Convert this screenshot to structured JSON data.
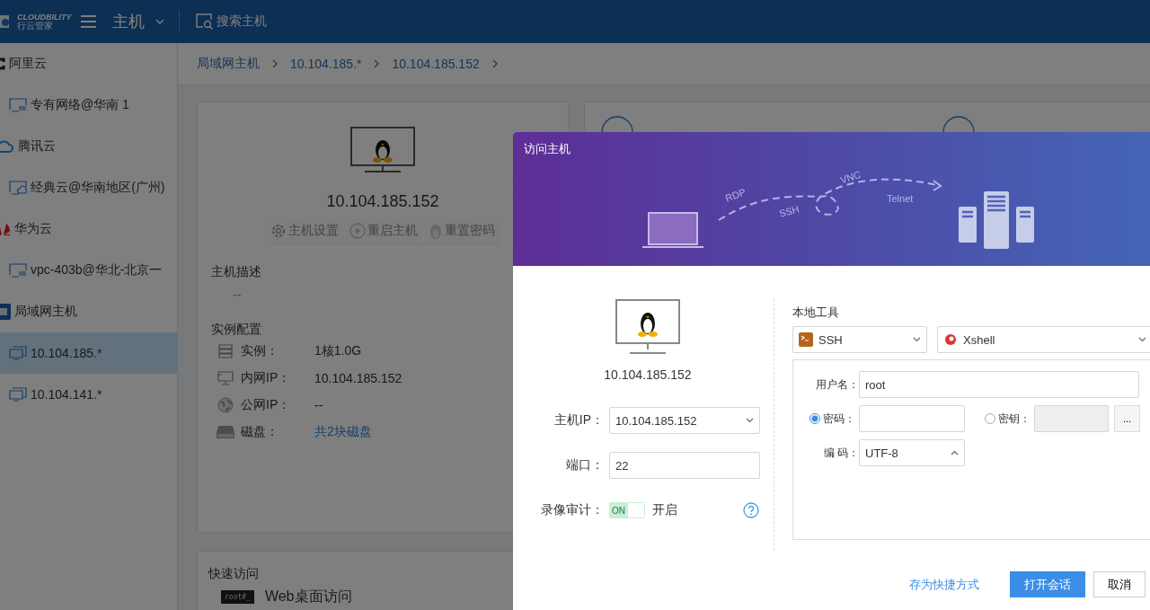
{
  "header": {
    "brand": "CLOUDBILITY",
    "brand_sub": "行云管家",
    "section": "主机",
    "search": "搜索主机"
  },
  "sidebar": {
    "items": [
      {
        "label": "阿里云",
        "kind": "aliyun",
        "selected": false,
        "children": [
          {
            "label": "专有网络@华南 1",
            "kind": "vpc",
            "selected": false
          }
        ]
      },
      {
        "label": "腾讯云",
        "kind": "tencent",
        "selected": false,
        "children": [
          {
            "label": "经典云@华南地区(广州)",
            "kind": "classic",
            "selected": false
          }
        ]
      },
      {
        "label": "华为云",
        "kind": "huawei",
        "selected": false,
        "children": [
          {
            "label": "vpc-403b@华北-北京一",
            "kind": "vpc",
            "selected": false
          }
        ]
      },
      {
        "label": "局域网主机",
        "kind": "lan",
        "selected": false,
        "children": [
          {
            "label": "10.104.185.*",
            "kind": "host",
            "selected": true
          },
          {
            "label": "10.104.141.*",
            "kind": "host",
            "selected": false
          }
        ]
      }
    ]
  },
  "breadcrumb": [
    "局域网主机",
    "10.104.185.*",
    "10.104.185.152"
  ],
  "host_card": {
    "ip": "10.104.185.152",
    "actions": [
      {
        "label": "主机设置",
        "kind": "gear"
      },
      {
        "label": "重启主机",
        "kind": "play"
      },
      {
        "label": "重置密码",
        "kind": "penguin"
      }
    ],
    "description_title": "主机描述",
    "description": "--",
    "config_title": "实例配置",
    "config": [
      {
        "kind": "instance",
        "label": "实例：",
        "value": "1核1.0G",
        "link": false
      },
      {
        "kind": "lan",
        "label": "内网IP：",
        "value": "10.104.185.152",
        "link": false
      },
      {
        "kind": "globe",
        "label": "公网IP：",
        "value": "--",
        "link": false
      },
      {
        "kind": "disk",
        "label": "磁盘：",
        "value": "共2块磁盘",
        "link": true
      }
    ]
  },
  "quick_access": {
    "title": "快速访问",
    "items": [
      {
        "icon_text": "root#_",
        "label": "Web桌面访问"
      }
    ]
  },
  "dialog": {
    "title": "访问主机",
    "protocols": [
      "RDP",
      "SSH",
      "VNC",
      "Telnet"
    ],
    "ip": "10.104.185.152",
    "host_ip_label": "主机IP：",
    "host_ip": "10.104.185.152",
    "port_label": "端口：",
    "port": "22",
    "record_label": "录像审计：",
    "record": {
      "on": true,
      "switch_text": "ON",
      "state_text": "开启"
    },
    "tools_title": "本地工具",
    "protocol_select": "SSH",
    "client_select": "Xshell",
    "username_label": "用户名：",
    "username": "root",
    "auth": [
      {
        "label": "密码：",
        "selected": true
      },
      {
        "label": "密钥：",
        "selected": false
      }
    ],
    "browse": "...",
    "encoding_label": "编 码：",
    "encoding": "UTF-8",
    "buttons": {
      "shortcut": "存为快捷方式",
      "open": "打开会话",
      "cancel": "取消"
    }
  }
}
